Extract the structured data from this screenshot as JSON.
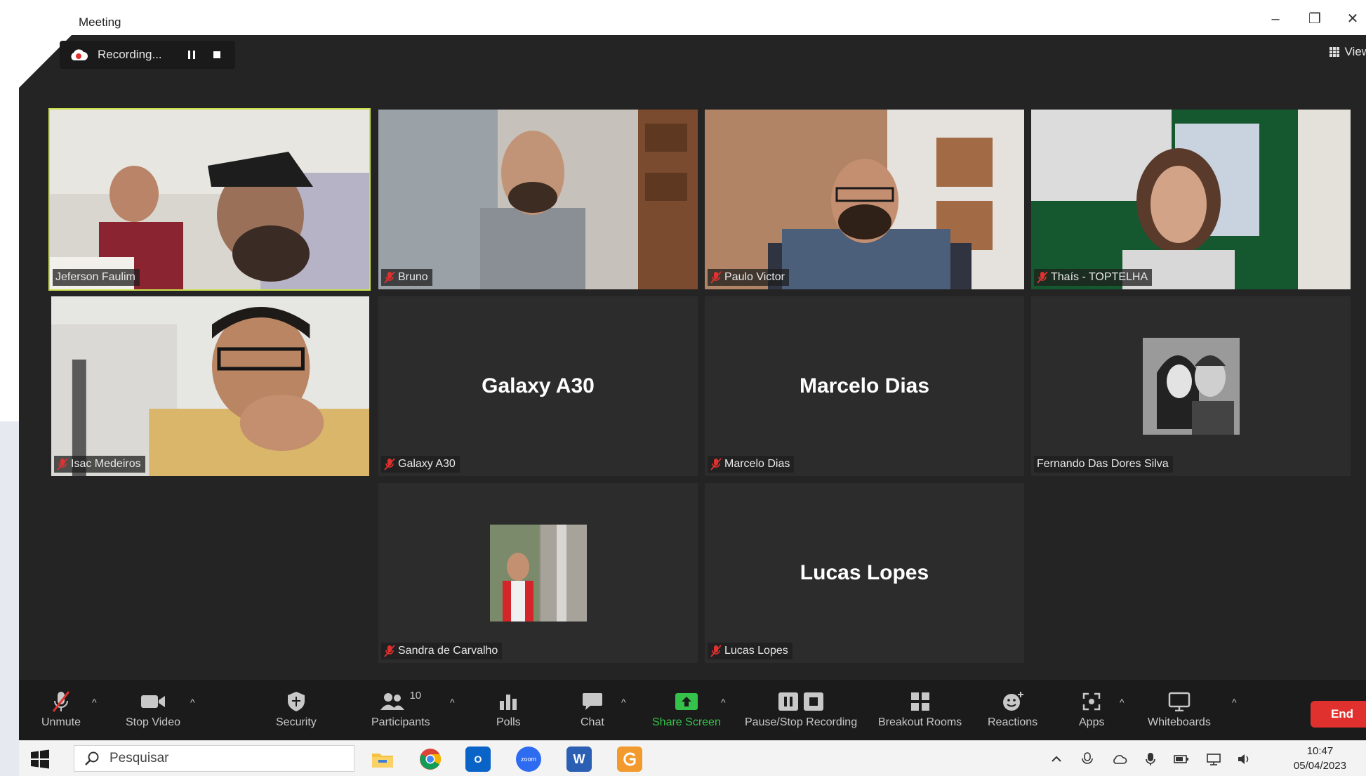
{
  "window": {
    "title": "Meeting",
    "minimize_label": "–",
    "restore_label": "❐",
    "close_label": "✕"
  },
  "recording": {
    "status": "Recording..."
  },
  "view": {
    "label": "View"
  },
  "participants": [
    {
      "name": "Jeferson Faulim",
      "video": true,
      "active": true,
      "muted": false
    },
    {
      "name": "Bruno",
      "video": true,
      "active": false,
      "muted": true
    },
    {
      "name": "Paulo Victor",
      "video": true,
      "active": false,
      "muted": true
    },
    {
      "name": "Thaís - TOPTELHA",
      "video": true,
      "active": false,
      "muted": true
    },
    {
      "name": "Isac Medeiros",
      "video": true,
      "active": false,
      "muted": true
    },
    {
      "name": "Galaxy A30",
      "big_name": "Galaxy A30",
      "video": false,
      "active": false,
      "muted": true
    },
    {
      "name": "Marcelo Dias",
      "big_name": "Marcelo Dias",
      "video": false,
      "active": false,
      "muted": true
    },
    {
      "name": "Fernando Das Dores Silva",
      "video": false,
      "avatar": true,
      "active": false,
      "muted": false
    },
    {
      "name": "Sandra de Carvalho",
      "video": false,
      "avatar": true,
      "active": false,
      "muted": true
    },
    {
      "name": "Lucas Lopes",
      "big_name": "Lucas Lopes",
      "video": false,
      "active": false,
      "muted": true
    }
  ],
  "toolbar": {
    "unmute": "Unmute",
    "stop_video": "Stop Video",
    "security": "Security",
    "participants": "Participants",
    "participants_count": "10",
    "polls": "Polls",
    "chat": "Chat",
    "share_screen": "Share Screen",
    "pause_stop_recording": "Pause/Stop Recording",
    "breakout_rooms": "Breakout Rooms",
    "reactions": "Reactions",
    "apps": "Apps",
    "whiteboards": "Whiteboards",
    "end": "End",
    "caret": "^"
  },
  "taskbar": {
    "search_placeholder": "Pesquisar",
    "time": "10:47",
    "date": "05/04/2023",
    "word_letter": "W",
    "outlook_letter": "O",
    "zoom_label": "zoom"
  },
  "colors": {
    "active_speaker": "#c9e04a",
    "share_green": "#35c24b",
    "end_red": "#e0312f",
    "muted_red": "#e0312f"
  }
}
